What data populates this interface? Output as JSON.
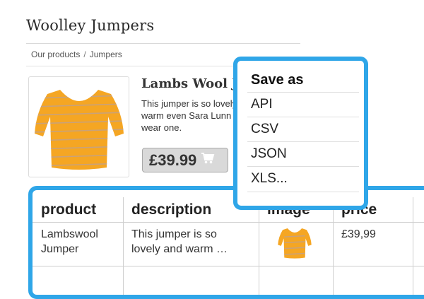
{
  "site": {
    "title": "Woolley Jumpers"
  },
  "breadcrumb": {
    "items": [
      "Our products",
      "Jumpers"
    ],
    "separator": "/"
  },
  "product": {
    "name": "Lambs Wool Jumper",
    "description_lines": [
      "This jumper is so lovely and",
      "warm even Sara Lunn would",
      "wear one."
    ],
    "price": "£39.99",
    "cart_icon": "cart-icon",
    "image_icon": "jumper-icon"
  },
  "table": {
    "headers": [
      "product",
      "description",
      "image",
      "price"
    ],
    "rows": [
      {
        "product": [
          "Lambswool",
          "Jumper"
        ],
        "description": [
          "This jumper is so",
          "lovely and warm …"
        ],
        "image": "jumper-icon",
        "price": "£39,99"
      }
    ]
  },
  "save_menu": {
    "title": "Save as",
    "options": [
      "API",
      "CSV",
      "JSON",
      "XLS..."
    ]
  },
  "colors": {
    "accent": "#2fa6e8",
    "jumper": "#f5a623",
    "stripes": "#c9a27a",
    "price_bg": "#d9d9d9"
  }
}
